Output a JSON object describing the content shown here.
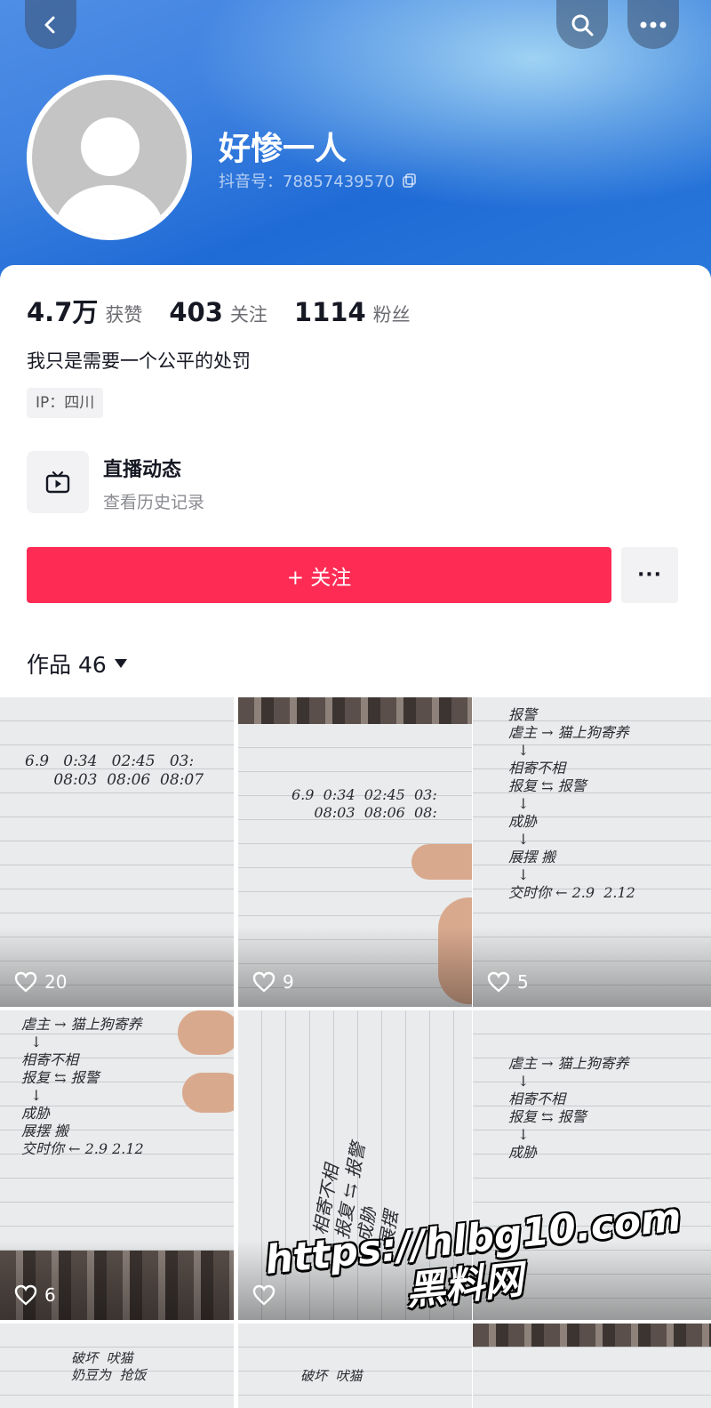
{
  "profile": {
    "nickname": "好惨一人",
    "douyin_id": "抖音号：78857439570"
  },
  "stats": [
    {
      "value": "4.7万",
      "label": "获赞"
    },
    {
      "value": "403",
      "label": "关注"
    },
    {
      "value": "1114",
      "label": "粉丝"
    }
  ],
  "bio": "我只是需要一个公平的处罚",
  "ip": "IP：四川",
  "live": {
    "title": "直播动态",
    "subtitle": "查看历史记录"
  },
  "actions": {
    "follow": "+ 关注",
    "more": "···"
  },
  "works": {
    "label": "作品 46"
  },
  "videos": [
    {
      "likes": "20",
      "text": "6.9   0:34   02:45   03:\n      08:03  08:06  08:07"
    },
    {
      "likes": "9",
      "text": "6.9  0:34  02:45  03:\n     08:03  08:06  08:"
    },
    {
      "likes": "5",
      "text": "报警\n虐主 → 猫上狗寄养\n  ↓\n相寄不相\n报复 ⇆ 报警\n  ↓\n成胁\n  ↓\n展摆 搬\n  ↓\n交时你 ← 2.9  2.12"
    },
    {
      "likes": "6",
      "text": "虐主 → 猫上狗寄养\n  ↓\n相寄不相\n报复 ⇆ 报警\n  ↓\n成胁\n展摆 搬\n交时你 ← 2.9 2.12"
    },
    {
      "likes": "",
      "text": "相寄不相\n报复 ⇆ 报警\n成胁\n展摆"
    },
    {
      "likes": "",
      "text": "虐主 → 猫上狗寄养\n  ↓\n相寄不相\n报复 ⇆ 报警\n  ↓\n成胁"
    },
    {
      "likes": "",
      "text": "破坏  吠猫\n奶豆为  抢饭"
    },
    {
      "likes": "",
      "text": "破坏  吠猫\n"
    },
    {
      "likes": "",
      "text": ""
    }
  ],
  "watermark": {
    "line1": "https://hlbg10.com",
    "line2": "黑料网"
  }
}
